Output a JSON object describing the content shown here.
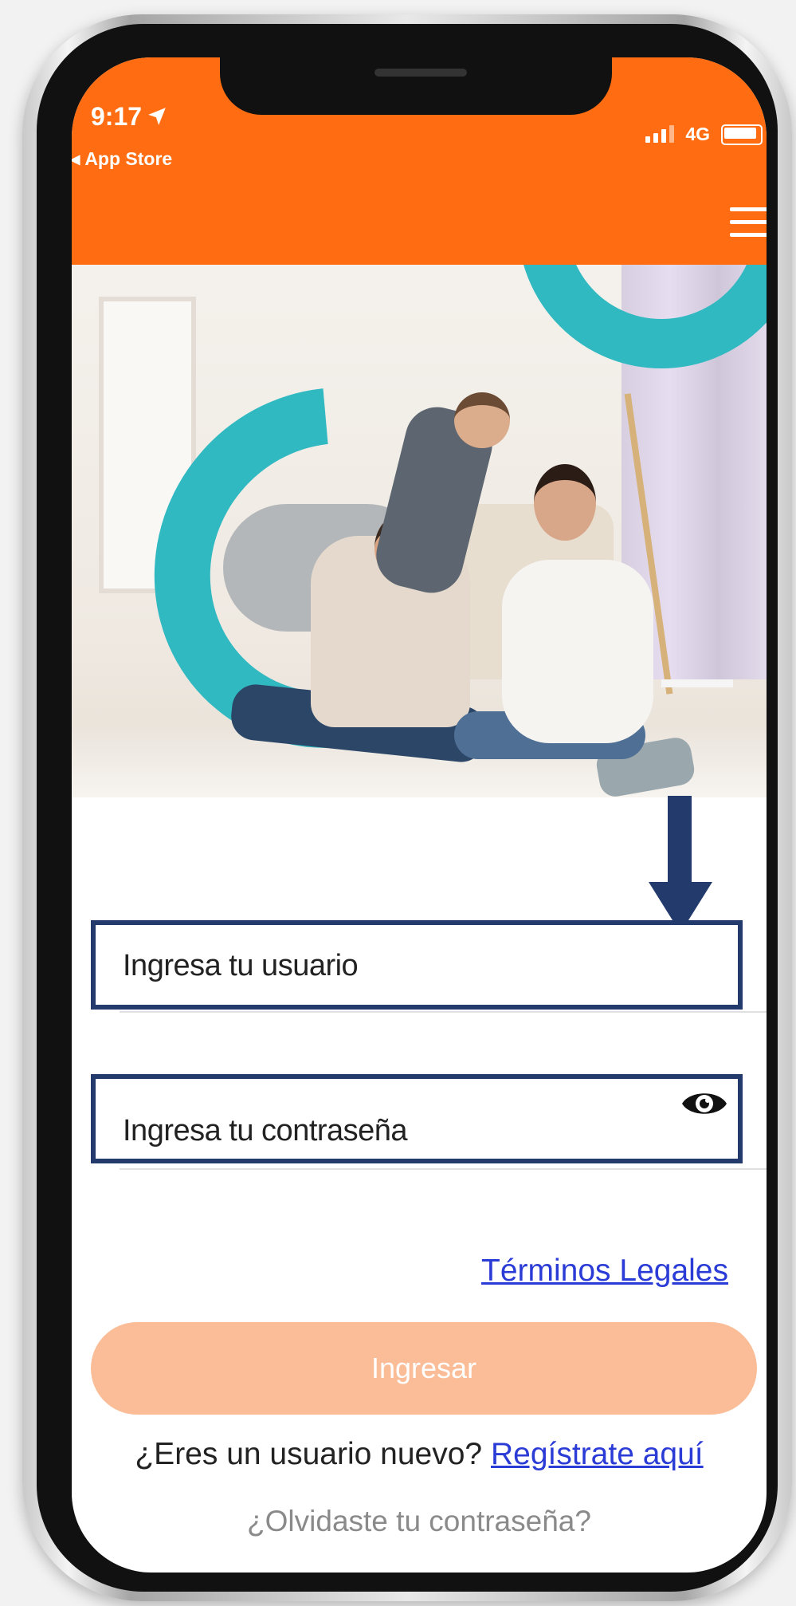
{
  "status_bar": {
    "time": "9:17",
    "back_app": "App Store",
    "network": "4G",
    "background_color": "#ff6c11"
  },
  "icons": {
    "location": "location-arrow-icon",
    "signal": "signal-bars-icon",
    "battery": "battery-icon",
    "menu": "hamburger-menu-icon",
    "eye": "eye-icon",
    "arrow": "down-arrow-icon"
  },
  "login": {
    "username_placeholder": "Ingresa tu usuario",
    "password_placeholder": "Ingresa tu contraseña",
    "legal_link": "Términos Legales",
    "submit_label": "Ingresar",
    "new_user_text": "¿Eres un usuario nuevo? ",
    "register_link": "Regístrate aquí",
    "forgot_password": "¿Olvidaste tu contraseña?"
  },
  "colors": {
    "brand_orange": "#ff6c11",
    "button_disabled": "#fbbd97",
    "highlight_border": "#233a6c",
    "link": "#2a3bd6",
    "teal_accent": "#31b9c2"
  }
}
